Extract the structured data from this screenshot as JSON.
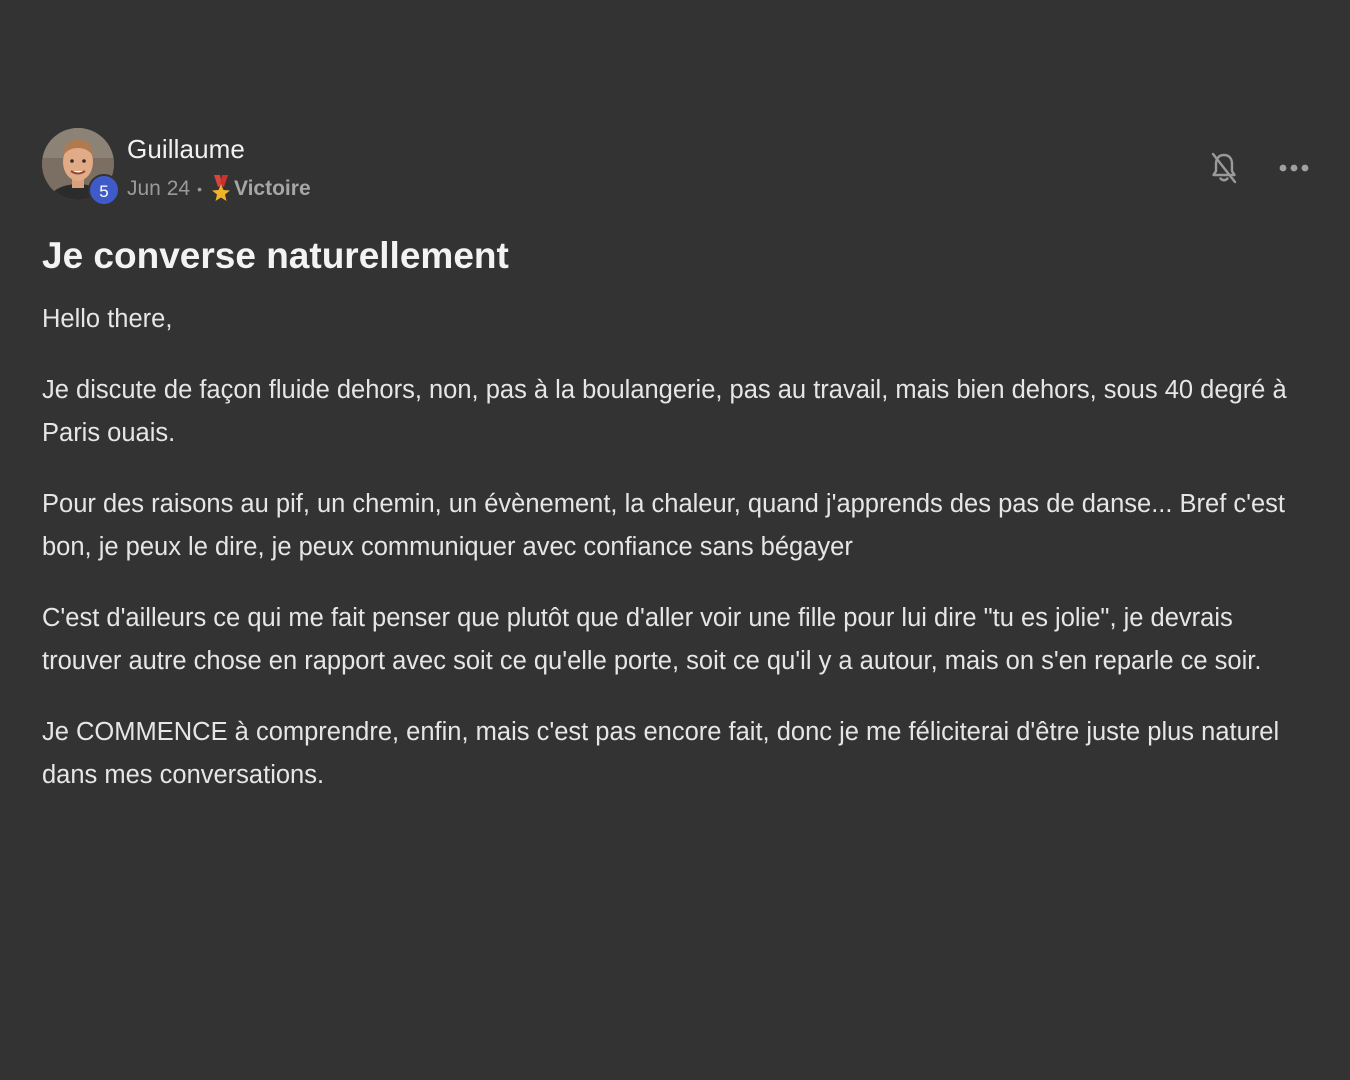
{
  "post": {
    "author": "Guillaume",
    "level": "5",
    "date": "Jun 24",
    "separator": "•",
    "category": "Victoire",
    "title": "Je converse naturellement",
    "paragraphs": [
      "Hello there,",
      "Je discute de façon fluide dehors, non, pas à la boulangerie, pas au travail, mais bien dehors, sous 40 degré à Paris ouais.",
      "Pour des raisons au pif, un chemin, un évènement, la chaleur, quand j'apprends des pas de danse... Bref c'est bon, je peux le dire, je peux communiquer avec confiance sans bégayer",
      "C'est d'ailleurs ce qui me fait penser que plutôt que d'aller voir une fille pour lui dire \"tu es jolie\", je devrais trouver autre chose en rapport avec soit ce qu'elle porte, soit ce qu'il y a autour, mais on s'en reparle ce soir.",
      "Je COMMENCE à comprendre, enfin, mais c'est pas encore fait, donc je me féliciterai d'être juste plus naturel dans mes conversations."
    ]
  },
  "icons": {
    "avatar": "avatar-photo",
    "category": "medal-icon",
    "notifications": "bell-off-icon",
    "more": "more-options-icon"
  },
  "colors": {
    "background": "#333333",
    "text": "#e6e6e6",
    "muted": "#9a9a9a",
    "level_badge": "#3f5bc9"
  }
}
